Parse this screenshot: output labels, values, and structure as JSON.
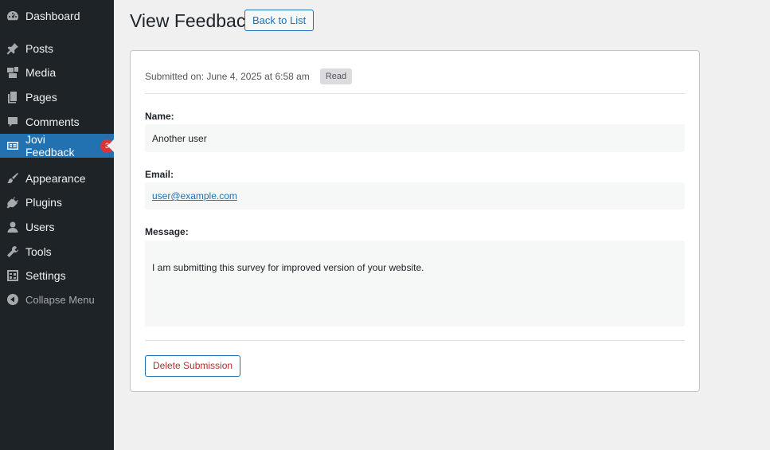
{
  "sidebar": {
    "items": [
      {
        "label": "Dashboard",
        "icon": "dashboard-icon"
      },
      {
        "label": "Posts",
        "icon": "pin-icon"
      },
      {
        "label": "Media",
        "icon": "media-icon"
      },
      {
        "label": "Pages",
        "icon": "pages-icon"
      },
      {
        "label": "Comments",
        "icon": "comment-icon"
      },
      {
        "label": "Jovi Feedback",
        "icon": "feedback-form-icon",
        "badge": "3",
        "active": true
      },
      {
        "label": "Appearance",
        "icon": "paintbrush-icon"
      },
      {
        "label": "Plugins",
        "icon": "plugin-icon"
      },
      {
        "label": "Users",
        "icon": "user-icon"
      },
      {
        "label": "Tools",
        "icon": "wrench-icon"
      },
      {
        "label": "Settings",
        "icon": "settings-icon"
      },
      {
        "label": "Collapse Menu",
        "icon": "collapse-arrow-icon"
      }
    ]
  },
  "header": {
    "title": "View Feedback",
    "back_button": "Back to List"
  },
  "submission": {
    "submitted_on": "Submitted on: June 4, 2025 at 6:58 am",
    "status": "Read",
    "name_label": "Name:",
    "name_value": "Another user",
    "email_label": "Email:",
    "email_value": "user@example.com",
    "message_label": "Message:",
    "message_value": "I am submitting this survey for improved version of your website.",
    "delete_button": "Delete Submission"
  },
  "colors": {
    "sidebar_bg": "#1d2327",
    "accent": "#2271b1",
    "badge": "#d63638",
    "danger_text": "#b32d2e"
  }
}
